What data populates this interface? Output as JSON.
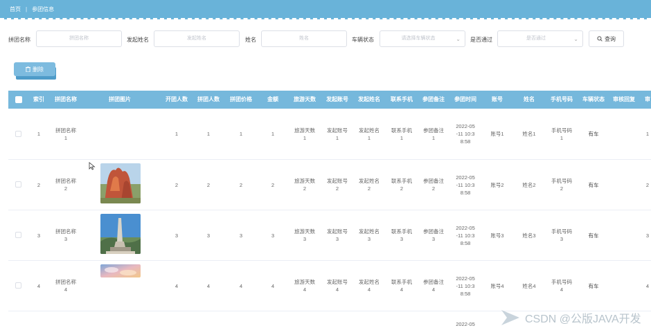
{
  "breadcrumb": {
    "home": "首页",
    "separator": "|",
    "current": "参团信息"
  },
  "search": {
    "group_name_label": "拼团名称",
    "group_name_placeholder": "拼团名称",
    "initiator_label": "发起姓名",
    "initiator_placeholder": "发起姓名",
    "name_label": "姓名",
    "name_placeholder": "姓名",
    "vehicle_label": "车辆状态",
    "vehicle_placeholder": "请选择车辆状态",
    "approved_label": "是否通过",
    "approved_placeholder": "是否通过",
    "query_button": "查询"
  },
  "actions": {
    "delete_button": "删除"
  },
  "table": {
    "columns": [
      "索引",
      "拼团名称",
      "拼团图片",
      "开团人数",
      "拼团人数",
      "拼团价格",
      "金额",
      "旅游天数",
      "发起账号",
      "发起姓名",
      "联系手机",
      "参团备注",
      "参团时间",
      "账号",
      "姓名",
      "手机号码",
      "车辆状态",
      "审核回复",
      "审"
    ],
    "rows": [
      {
        "index": "1",
        "name": [
          "拼团名称",
          "1"
        ],
        "open": "1",
        "count": "1",
        "price": "1",
        "amount": "1",
        "days": [
          "旅游天数",
          "1"
        ],
        "acct": [
          "发起账号",
          "1"
        ],
        "iname": [
          "发起姓名",
          "1"
        ],
        "phone": [
          "联系手机",
          "1"
        ],
        "note": [
          "参团备注",
          "1"
        ],
        "time": [
          "2022-05",
          "-11 10:3",
          "8:58"
        ],
        "user": "账号1",
        "uname": "姓名1",
        "mobile": [
          "手机号码",
          "1"
        ],
        "vehicle": "有车",
        "reply": "",
        "extra": ""
      },
      {
        "index": "2",
        "name": [
          "拼团名称",
          "2"
        ],
        "open": "2",
        "count": "2",
        "price": "2",
        "amount": "2",
        "days": [
          "旅游天数",
          "2"
        ],
        "acct": [
          "发起账号",
          "2"
        ],
        "iname": [
          "发起姓名",
          "2"
        ],
        "phone": [
          "联系手机",
          "2"
        ],
        "note": [
          "参团备注",
          "2"
        ],
        "time": [
          "2022-05",
          "-11 10:3",
          "8:58"
        ],
        "user": "账号2",
        "uname": "姓名2",
        "mobile": [
          "手机号码",
          "2"
        ],
        "vehicle": "有车",
        "reply": "",
        "extra": ""
      },
      {
        "index": "3",
        "name": [
          "拼团名称",
          "3"
        ],
        "open": "3",
        "count": "3",
        "price": "3",
        "amount": "3",
        "days": [
          "旅游天数",
          "3"
        ],
        "acct": [
          "发起账号",
          "3"
        ],
        "iname": [
          "发起姓名",
          "3"
        ],
        "phone": [
          "联系手机",
          "3"
        ],
        "note": [
          "参团备注",
          "3"
        ],
        "time": [
          "2022-05",
          "-11 10:3",
          "8:58"
        ],
        "user": "账号3",
        "uname": "姓名3",
        "mobile": [
          "手机号码",
          "3"
        ],
        "vehicle": "有车",
        "reply": "",
        "extra": ""
      },
      {
        "index": "4",
        "name": [
          "拼团名称",
          "4"
        ],
        "open": "4",
        "count": "4",
        "price": "4",
        "amount": "4",
        "days": [
          "旅游天数",
          "4"
        ],
        "acct": [
          "发起账号",
          "4"
        ],
        "iname": [
          "发起姓名",
          "4"
        ],
        "phone": [
          "联系手机",
          "4"
        ],
        "note": [
          "参团备注",
          "4"
        ],
        "time": [
          "2022-05",
          "-11 10:3",
          "8:58"
        ],
        "user": "账号4",
        "uname": "姓名4",
        "mobile": [
          "手机号码",
          "4"
        ],
        "vehicle": "有车",
        "reply": "",
        "extra": ""
      }
    ],
    "partial_row_time": "2022-05"
  },
  "watermark": "CSDN @公版JAVA开发",
  "colors": {
    "accent": "#69b3d9",
    "header": "#76b8dc"
  }
}
